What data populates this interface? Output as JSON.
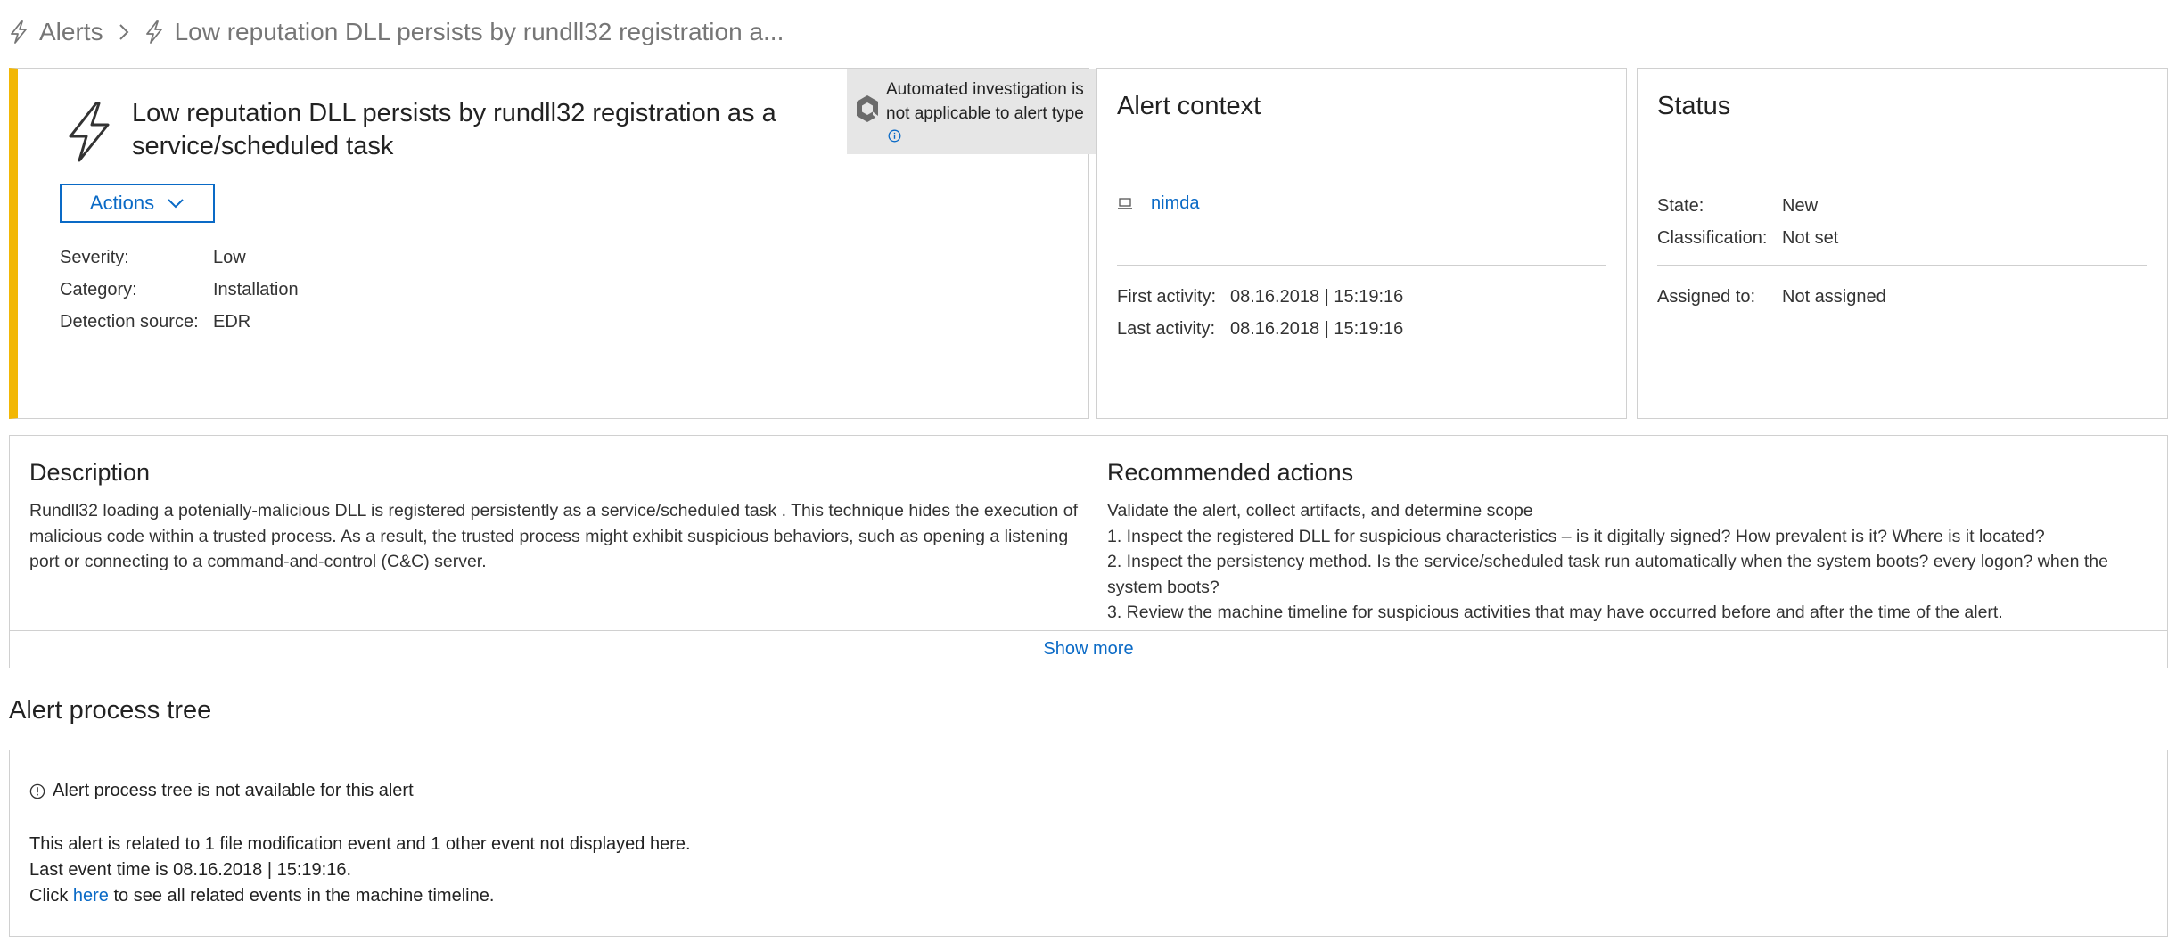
{
  "breadcrumb": {
    "root": "Alerts",
    "current": "Low reputation DLL persists by rundll32 registration a..."
  },
  "alert": {
    "title": "Low reputation DLL persists by rundll32 registration as a service/scheduled task",
    "actions_label": "Actions",
    "severity_label": "Severity:",
    "severity": "Low",
    "category_label": "Category:",
    "category": "Installation",
    "detection_label": "Detection source:",
    "detection": "EDR",
    "automated_text": "Automated investigation is not applicable to alert type"
  },
  "context": {
    "title": "Alert context",
    "machine": "nimda",
    "first_label": "First activity:",
    "first": "08.16.2018 | 15:19:16",
    "last_label": "Last activity:",
    "last": "08.16.2018 | 15:19:16"
  },
  "status": {
    "title": "Status",
    "state_label": "State:",
    "state": "New",
    "class_label": "Classification:",
    "class": "Not set",
    "assigned_label": "Assigned to:",
    "assigned": "Not assigned"
  },
  "description": {
    "title": "Description",
    "text": "Rundll32 loading a potenially-malicious DLL is registered persistently as a service/scheduled task . This technique hides the execution of malicious code within a trusted process. As a result, the trusted process might exhibit suspicious behaviors, such as opening a listening port or connecting to a command-and-control (C&C) server."
  },
  "recommended": {
    "title": "Recommended actions",
    "lines": [
      "Validate the alert, collect artifacts, and determine scope",
      "1. Inspect the registered DLL for suspicious characteristics – is it digitally signed? How prevalent is it? Where is it located?",
      "2. Inspect the persistency method. Is the service/scheduled task run automatically when the system boots? every logon? when the system boots?",
      "3. Review the machine timeline for suspicious activities that may have occurred before and after the time of the alert."
    ],
    "show_more": "Show more"
  },
  "process_tree": {
    "title": "Alert process tree",
    "note": "Alert process tree is not available for this alert",
    "line1": "This alert is related to 1 file modification event and 1 other event not displayed here.",
    "line2": "Last event time is 08.16.2018 | 15:19:16.",
    "click_prefix": "Click ",
    "link": "here",
    "click_suffix": " to see all related events in the machine timeline."
  },
  "colors": {
    "accent_severity": "#f2b705",
    "link": "#0a6ac6"
  },
  "icons": {
    "breadcrumb": "lightning-icon",
    "separator": "chevron-right-icon",
    "alert": "lightning-icon",
    "automated": "hexagon-icon",
    "info": "info-icon",
    "machine": "laptop-icon",
    "dropdown": "chevron-down-icon"
  }
}
